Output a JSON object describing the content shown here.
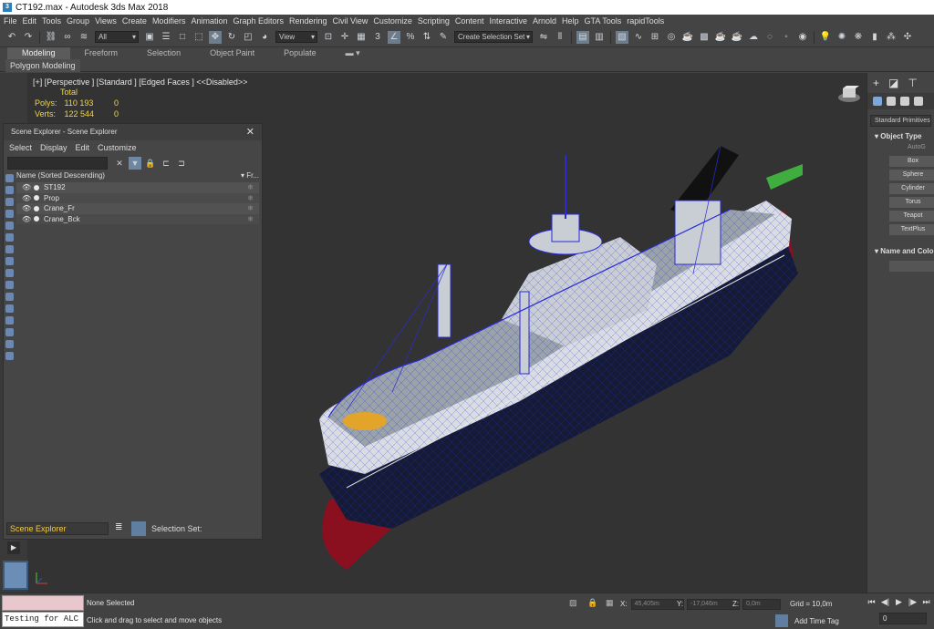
{
  "window": {
    "title": "CT192.max - Autodesk 3ds Max 2018"
  },
  "menubar": {
    "items": [
      "File",
      "Edit",
      "Tools",
      "Group",
      "Views",
      "Create",
      "Modifiers",
      "Animation",
      "Graph Editors",
      "Rendering",
      "Civil View",
      "Customize",
      "Scripting",
      "Content",
      "Interactive",
      "Arnold",
      "Help",
      "GTA Tools",
      "rapidTools"
    ]
  },
  "toolbar": {
    "selection_filter": "All",
    "ref_coord": "View",
    "selection_set": "Create Selection Set"
  },
  "ribbon": {
    "tabs": [
      "Modeling",
      "Freeform",
      "Selection",
      "Object Paint",
      "Populate"
    ],
    "active_tab": "Modeling",
    "sub_panel": "Polygon Modeling"
  },
  "viewport": {
    "label": "[+] [Perspective ] [Standard ] [Edged Faces ] <<Disabled>>",
    "stats": {
      "total_label": "Total",
      "polys_label": "Polys:",
      "polys_value": "110 193",
      "polys_sel": "0",
      "verts_label": "Verts:",
      "verts_value": "122 544",
      "verts_sel": "0"
    }
  },
  "scene_explorer": {
    "title": "Scene Explorer - Scene Explorer",
    "menu": [
      "Select",
      "Display",
      "Edit",
      "Customize"
    ],
    "column_name": "Name (Sorted Descending)",
    "column_freeze": "▾ Fr...",
    "rows": [
      {
        "name": "ST192"
      },
      {
        "name": "Prop"
      },
      {
        "name": "Crane_Fr"
      },
      {
        "name": "Crane_Bck"
      }
    ],
    "explorer_select": "Scene Explorer",
    "selection_set_label": "Selection Set:"
  },
  "command_panel": {
    "category": "Standard Primitives",
    "object_type_label": "Object Type",
    "autogrid": "AutoG",
    "buttons": [
      "Box",
      "Sphere",
      "Cylinder",
      "Torus",
      "Teapot",
      "TextPlus"
    ],
    "name_color_label": "Name and Color"
  },
  "status": {
    "maxscript_value": "Testing for ALC",
    "selection": "None Selected",
    "prompt": "Click and drag to select and move objects",
    "x_label": "X:",
    "x_value": "45,405m",
    "y_label": "Y:",
    "y_value": "-17,046m",
    "z_label": "Z:",
    "z_value": "0,0m",
    "grid": "Grid = 10,0m",
    "add_time_tag": "Add Time Tag",
    "frame": "0"
  },
  "colors": {
    "hull_red": "#8a1020",
    "hull_dark": "#151b35",
    "wire_blue": "#2b2bd6",
    "deck_grey": "#9aa3aa",
    "helipad_yellow": "#e2a52a",
    "crane_green": "#3fae3f"
  }
}
